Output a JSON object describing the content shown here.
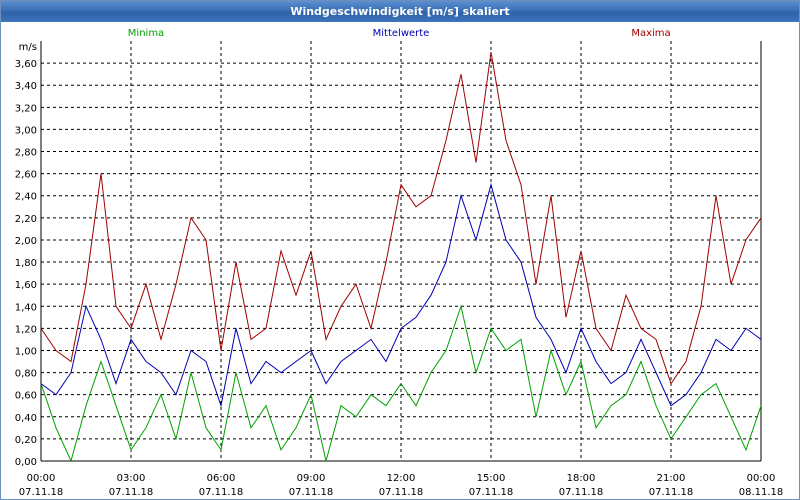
{
  "window": {
    "title": "Windgeschwindigkeit [m/s] skaliert"
  },
  "chart_data": {
    "type": "line",
    "title": "Windgeschwindigkeit [m/s] skaliert",
    "ylabel": "m/s",
    "xlabel": "",
    "ylim": [
      0,
      3.8
    ],
    "yticks": [
      "0,00",
      "0,20",
      "0,40",
      "0,60",
      "0,80",
      "1,00",
      "1,20",
      "1,40",
      "1,60",
      "1,80",
      "2,00",
      "2,20",
      "2,40",
      "2,60",
      "2,80",
      "3,00",
      "3,20",
      "3,40",
      "3,60"
    ],
    "xticks": [
      {
        "time": "00:00",
        "date": "07.11.18"
      },
      {
        "time": "03:00",
        "date": "07.11.18"
      },
      {
        "time": "06:00",
        "date": "07.11.18"
      },
      {
        "time": "09:00",
        "date": "07.11.18"
      },
      {
        "time": "12:00",
        "date": "07.11.18"
      },
      {
        "time": "15:00",
        "date": "07.11.18"
      },
      {
        "time": "18:00",
        "date": "07.11.18"
      },
      {
        "time": "21:00",
        "date": "07.11.18"
      },
      {
        "time": "00:00",
        "date": "08.11.18"
      }
    ],
    "x": [
      "00:00",
      "00:30",
      "01:00",
      "01:30",
      "02:00",
      "02:30",
      "03:00",
      "03:30",
      "04:00",
      "04:30",
      "05:00",
      "05:30",
      "06:00",
      "06:30",
      "07:00",
      "07:30",
      "08:00",
      "08:30",
      "09:00",
      "09:30",
      "10:00",
      "10:30",
      "11:00",
      "11:30",
      "12:00",
      "12:30",
      "13:00",
      "13:30",
      "14:00",
      "14:30",
      "15:00",
      "15:30",
      "16:00",
      "16:30",
      "17:00",
      "17:30",
      "18:00",
      "18:30",
      "19:00",
      "19:30",
      "20:00",
      "20:30",
      "21:00",
      "21:30",
      "22:00",
      "22:30",
      "23:00",
      "23:30",
      "24:00"
    ],
    "grid": true,
    "legend_position": "top",
    "series": [
      {
        "name": "Minima",
        "color": "#00a000",
        "values": [
          0.7,
          0.3,
          0.0,
          0.5,
          0.9,
          0.5,
          0.1,
          0.3,
          0.6,
          0.2,
          0.8,
          0.3,
          0.1,
          0.8,
          0.3,
          0.5,
          0.1,
          0.3,
          0.6,
          0.0,
          0.5,
          0.4,
          0.6,
          0.5,
          0.7,
          0.5,
          0.8,
          1.0,
          1.4,
          0.8,
          1.2,
          1.0,
          1.1,
          0.4,
          1.0,
          0.6,
          0.9,
          0.3,
          0.5,
          0.6,
          0.9,
          0.5,
          0.2,
          0.4,
          0.6,
          0.7,
          0.4,
          0.1,
          0.5
        ]
      },
      {
        "name": "Mittelwerte",
        "color": "#0000b0",
        "values": [
          0.7,
          0.6,
          0.8,
          1.4,
          1.1,
          0.7,
          1.1,
          0.9,
          0.8,
          0.6,
          1.0,
          0.9,
          0.5,
          1.2,
          0.7,
          0.9,
          0.8,
          0.9,
          1.0,
          0.7,
          0.9,
          1.0,
          1.1,
          0.9,
          1.2,
          1.3,
          1.5,
          1.8,
          2.4,
          2.0,
          2.5,
          2.0,
          1.8,
          1.3,
          1.1,
          0.8,
          1.2,
          0.9,
          0.7,
          0.8,
          1.1,
          0.8,
          0.5,
          0.6,
          0.8,
          1.1,
          1.0,
          1.2,
          1.1
        ]
      },
      {
        "name": "Maxima",
        "color": "#a00000",
        "values": [
          1.2,
          1.0,
          0.9,
          1.6,
          2.6,
          1.4,
          1.2,
          1.6,
          1.1,
          1.6,
          2.2,
          2.0,
          1.0,
          1.8,
          1.1,
          1.2,
          1.9,
          1.5,
          1.9,
          1.1,
          1.4,
          1.6,
          1.2,
          1.8,
          2.5,
          2.3,
          2.4,
          2.9,
          3.5,
          2.7,
          3.7,
          2.9,
          2.5,
          1.6,
          2.4,
          1.3,
          1.9,
          1.2,
          1.0,
          1.5,
          1.2,
          1.1,
          0.7,
          0.9,
          1.4,
          2.4,
          1.6,
          2.0,
          2.2
        ]
      }
    ]
  }
}
